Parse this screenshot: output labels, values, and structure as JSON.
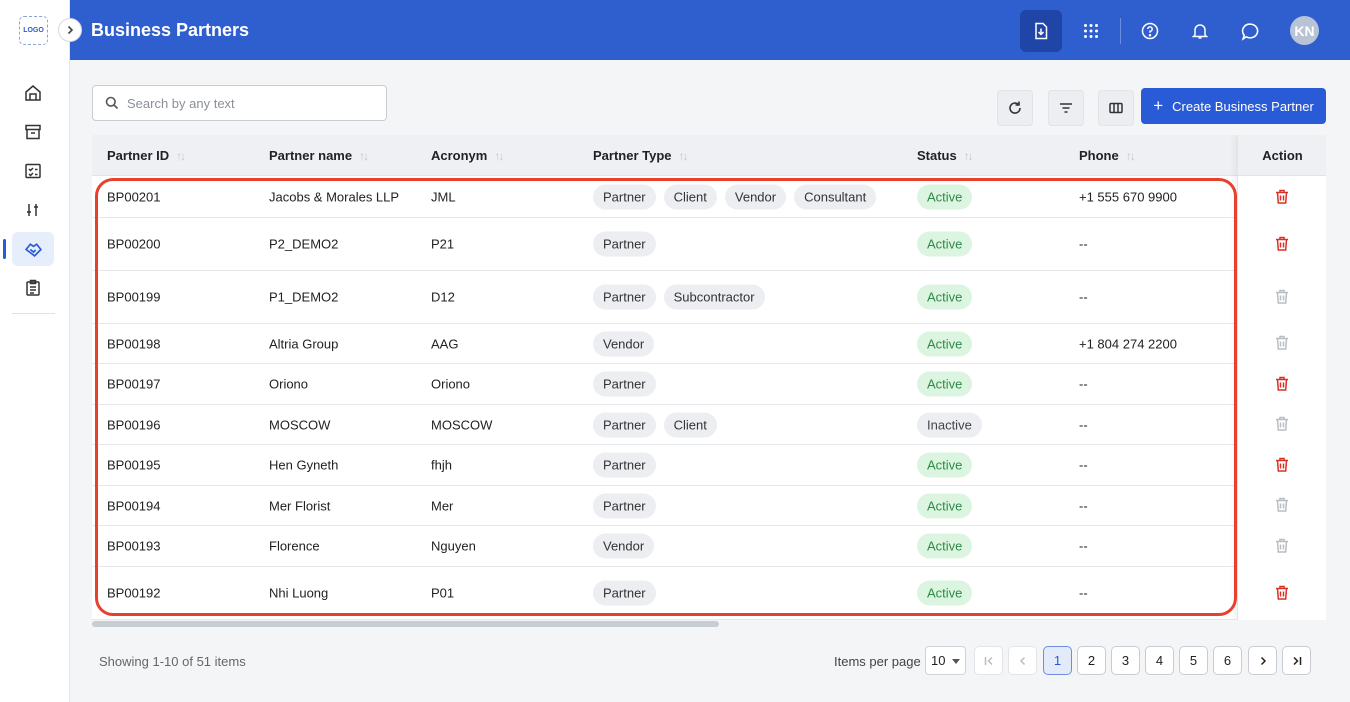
{
  "app": {
    "logo_text": "LOGO",
    "page_title": "Business Partners"
  },
  "header": {
    "avatar_initials": "KN"
  },
  "search": {
    "placeholder": "Search by any text"
  },
  "toolbar": {
    "create_label": "Create Business Partner"
  },
  "columns": {
    "partner_id": "Partner ID",
    "partner_name": "Partner name",
    "acronym": "Acronym",
    "partner_type": "Partner Type",
    "status": "Status",
    "phone": "Phone",
    "action": "Action"
  },
  "rows": [
    {
      "id": "BP00201",
      "name": "Jacobs & Morales LLP",
      "acronym": "JML",
      "types": [
        "Partner",
        "Client",
        "Vendor",
        "Consultant"
      ],
      "status": "Active",
      "phone": "+1 555 670 9900",
      "delete_enabled": true
    },
    {
      "id": "BP00200",
      "name": "P2_DEMO2",
      "acronym": "P21",
      "types": [
        "Partner"
      ],
      "status": "Active",
      "phone": "--",
      "delete_enabled": true
    },
    {
      "id": "BP00199",
      "name": "P1_DEMO2",
      "acronym": "D12",
      "types": [
        "Partner",
        "Subcontractor"
      ],
      "status": "Active",
      "phone": "--",
      "delete_enabled": false
    },
    {
      "id": "BP00198",
      "name": "Altria Group",
      "acronym": "AAG",
      "types": [
        "Vendor"
      ],
      "status": "Active",
      "phone": "+1 804 274 2200",
      "delete_enabled": false
    },
    {
      "id": "BP00197",
      "name": "Oriono",
      "acronym": "Oriono",
      "types": [
        "Partner"
      ],
      "status": "Active",
      "phone": "--",
      "delete_enabled": true
    },
    {
      "id": "BP00196",
      "name": "MOSCOW",
      "acronym": "MOSCOW",
      "types": [
        "Partner",
        "Client"
      ],
      "status": "Inactive",
      "phone": "--",
      "delete_enabled": false
    },
    {
      "id": "BP00195",
      "name": "Hen Gyneth",
      "acronym": "fhjh",
      "types": [
        "Partner"
      ],
      "status": "Active",
      "phone": "--",
      "delete_enabled": true
    },
    {
      "id": "BP00194",
      "name": "Mer Florist",
      "acronym": "Mer",
      "types": [
        "Partner"
      ],
      "status": "Active",
      "phone": "--",
      "delete_enabled": false
    },
    {
      "id": "BP00193",
      "name": "Florence",
      "acronym": "Nguyen",
      "types": [
        "Vendor"
      ],
      "status": "Active",
      "phone": "--",
      "delete_enabled": false
    },
    {
      "id": "BP00192",
      "name": "Nhi Luong",
      "acronym": "P01",
      "types": [
        "Partner"
      ],
      "status": "Active",
      "phone": "--",
      "delete_enabled": true
    }
  ],
  "footer": {
    "showing": "Showing 1-10 of 51 items",
    "items_per_page_label": "Items per page",
    "items_per_page_value": "10",
    "pages": [
      "1",
      "2",
      "3",
      "4",
      "5",
      "6"
    ],
    "current_page": "1"
  },
  "colors": {
    "header_bg": "#2f5fce",
    "accent": "#2a5bd7",
    "active_status_bg": "#dcf5e1",
    "active_status_text": "#2f8a48",
    "delete_enabled": "#d93025",
    "delete_disabled": "#b9bdc4",
    "highlight_border": "#e8402f"
  },
  "icons": {
    "sidebar": [
      "home-icon",
      "archive-icon",
      "checklist-icon",
      "sliders-icon",
      "handshake-icon",
      "clipboard-icon"
    ],
    "header": [
      "download-icon",
      "apps-grid-icon",
      "help-icon",
      "bell-icon",
      "chat-icon"
    ]
  }
}
